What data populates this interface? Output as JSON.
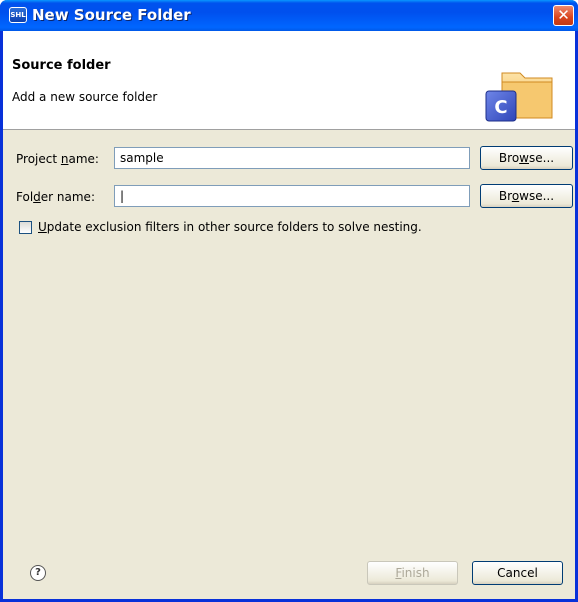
{
  "window": {
    "title": "New Source Folder",
    "app_icon_text": "SHL"
  },
  "header": {
    "title": "Source folder",
    "description": "Add a new source folder",
    "banner_letter": "C"
  },
  "form": {
    "project_label": {
      "pre": "Project ",
      "mn": "n",
      "post": "ame:"
    },
    "project_value": "sample",
    "project_browse": {
      "pre": "Bro",
      "mn": "w",
      "post": "se..."
    },
    "folder_label": {
      "pre": "Fol",
      "mn": "d",
      "post": "er name:"
    },
    "folder_value": "|",
    "folder_browse": {
      "pre": "Br",
      "mn": "o",
      "post": "wse..."
    },
    "checkbox": {
      "mn": "U",
      "post": "pdate exclusion filters in other source folders to solve nesting.",
      "checked": false
    }
  },
  "footer": {
    "help_icon": "?",
    "finish": {
      "mn": "F",
      "post": "inish",
      "enabled": false
    },
    "cancel": "Cancel"
  }
}
